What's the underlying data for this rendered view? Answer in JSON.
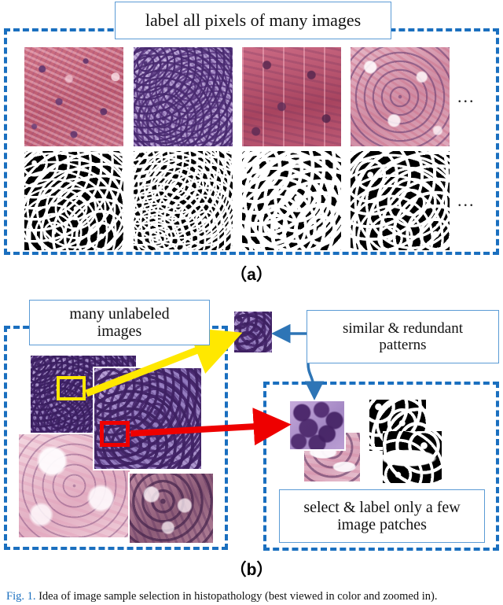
{
  "figure": {
    "caption_ref": "Fig. 1.",
    "caption_text": "Idea of image sample selection in histopathology (best viewed in color and zoomed in).",
    "panel_a_letter": "（a）",
    "panel_b_letter": "（b）",
    "ellipsis": "..."
  },
  "panel_a": {
    "title": "label all pixels of many images",
    "image_row_label": "histology image row",
    "mask_row_label": "ground-truth mask row",
    "images": [
      {
        "name": "histology-image-1",
        "style": "hist-a"
      },
      {
        "name": "histology-image-2",
        "style": "hist-b"
      },
      {
        "name": "histology-image-3",
        "style": "hist-c"
      },
      {
        "name": "histology-image-4",
        "style": "hist-d"
      }
    ],
    "masks": [
      {
        "name": "mask-image-1",
        "style": "mask-1"
      },
      {
        "name": "mask-image-2",
        "style": "mask-2"
      },
      {
        "name": "mask-image-3",
        "style": "mask-3"
      },
      {
        "name": "mask-image-4",
        "style": "mask-4"
      }
    ]
  },
  "panel_b": {
    "unlabeled_title_line1": "many unlabeled",
    "unlabeled_title_line2": "images",
    "similar_title_line1": "similar & redundant",
    "similar_title_line2": "patterns",
    "select_title_line1": "select & label only a few",
    "select_title_line2": "image patches",
    "unlabeled_images": [
      {
        "name": "unlabeled-image-1",
        "style": "hist-dense"
      },
      {
        "name": "unlabeled-image-2",
        "style": "hist-patch"
      },
      {
        "name": "unlabeled-image-3",
        "style": "hist-pale"
      },
      {
        "name": "unlabeled-image-4",
        "style": "hist-deep"
      }
    ],
    "highlight_yellow_label": "yellow-crop-box",
    "highlight_red_label": "red-crop-box",
    "extracted_patch_label": "extracted-patch-top",
    "selected_patches": [
      {
        "name": "selected-patch-1",
        "style": "hist-bigcell"
      },
      {
        "name": "selected-patch-2",
        "style": "hist-gland"
      }
    ],
    "selected_masks": [
      {
        "name": "selected-mask-1",
        "style": "mask-5"
      },
      {
        "name": "selected-mask-2",
        "style": "mask-6"
      }
    ]
  },
  "colors": {
    "dashed_blue": "#1a6fbf",
    "box_border_blue": "#5b9bd5",
    "arrow_yellow": "#ffe800",
    "arrow_red": "#ee0000",
    "arrow_blue": "#2e75b6",
    "highlight_yellow": "#ffe800",
    "highlight_red": "#ee0000"
  }
}
